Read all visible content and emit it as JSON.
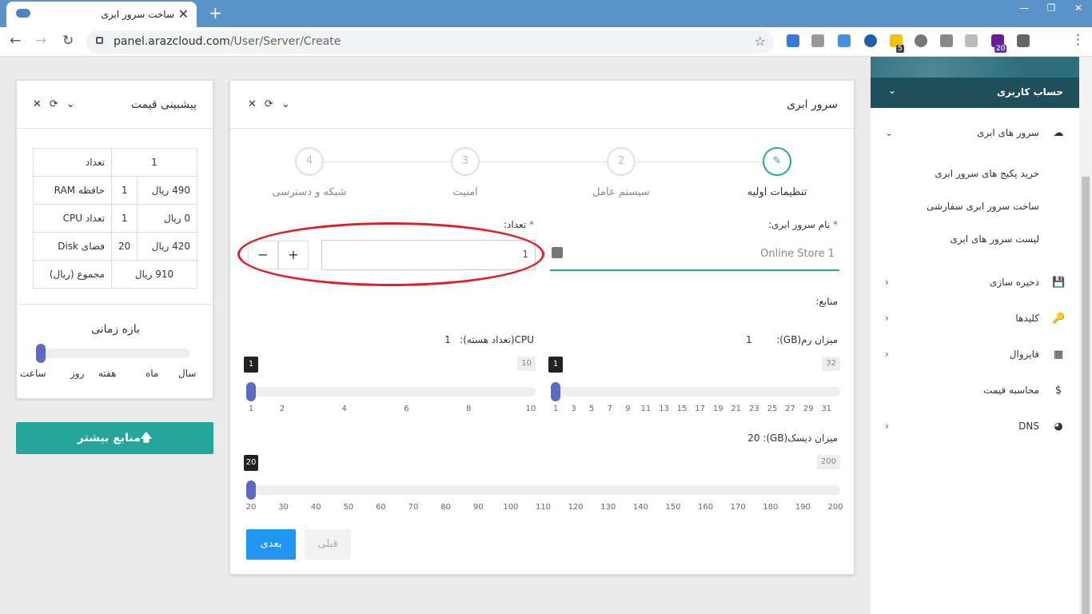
{
  "browser": {
    "tab_title": "ساخت سرور ابری",
    "tab_close": "✕",
    "new_tab": "+",
    "min": "—",
    "max": "❐",
    "close": "✕",
    "url_host": "panel.arazcloud.com",
    "url_path": "/User/Server/Create",
    "ext_badge_5": "5",
    "ext_badge_20": "20",
    "back": "←",
    "forward": "→",
    "reload": "↻",
    "star": "☆",
    "menu": "⋮"
  },
  "main": {
    "title": "سرور ابری",
    "ctrl_close": "✕",
    "ctrl_refresh": "⟳",
    "ctrl_collapse": "⌄",
    "steps": [
      {
        "num": "",
        "label": "تنظیمات اولیه"
      },
      {
        "num": "2",
        "label": "سیستم عامل"
      },
      {
        "num": "3",
        "label": "امنیت"
      },
      {
        "num": "4",
        "label": "شبکه و دسترسی"
      }
    ],
    "name_label": "نام سرور ابری:",
    "count_label": "تعداد:",
    "required": "*",
    "name_value": "Online Store 1",
    "count_value": "1",
    "minus": "−",
    "plus": "+",
    "resources_label": "منابع:",
    "ram_label": "میزان رم(GB):",
    "ram_value": "1",
    "cpu_label": "CPU(تعداد هسته):",
    "cpu_value": "1",
    "disk_label": "میزان دیسک(GB): 20",
    "ram_slider": {
      "value": 1,
      "min": 1,
      "max": 32,
      "max_label": "32",
      "tip": "1",
      "ticks": [
        "1",
        "3",
        "5",
        "7",
        "9",
        "11",
        "13",
        "15",
        "17",
        "19",
        "21",
        "23",
        "25",
        "27",
        "29",
        "31"
      ]
    },
    "cpu_slider": {
      "value": 1,
      "min": 1,
      "max": 10,
      "max_label": "10",
      "tip": "1",
      "ticks": [
        "1",
        "2",
        "4",
        "6",
        "8",
        "10"
      ]
    },
    "disk_slider": {
      "value": 20,
      "min": 20,
      "max": 200,
      "max_label": "200",
      "tip": "20",
      "ticks": [
        "20",
        "30",
        "40",
        "50",
        "60",
        "70",
        "80",
        "90",
        "100",
        "110",
        "120",
        "130",
        "140",
        "150",
        "160",
        "170",
        "180",
        "190",
        "200"
      ]
    },
    "next": "بعدی",
    "prev": "قبلی"
  },
  "price": {
    "title": "پیشبینی قیمت",
    "ctrl_close": "✕",
    "ctrl_refresh": "⟳",
    "ctrl_collapse": "⌄",
    "rows": {
      "count_label": "تعداد",
      "count_value": "1",
      "ram_label": "حافظه RAM",
      "ram_qty": "1",
      "ram_price": "490 ریال",
      "cpu_label": "تعداد CPU",
      "cpu_qty": "1",
      "cpu_price": "0 ریال",
      "disk_label": "فضای Disk",
      "disk_qty": "20",
      "disk_price": "420 ریال",
      "total_label": "مجموع (ریال)",
      "total_value": "910 ریال"
    },
    "period_title": "بازه زمانی",
    "period_labels": [
      "سال",
      "ماه",
      "هفته",
      "روز",
      "ساعت"
    ],
    "more_resources": "منابع بیشتر🡅"
  },
  "sidebar": {
    "account": "حساب کاربری",
    "account_chev": "⌄",
    "cloud_servers": "سرور های ابری",
    "cloud_chev": "⌄",
    "sub_items": [
      "خرید پکیج های سرور ابری",
      "ساخت سرور ابری سفارشی",
      "لیست سرور های ابری"
    ],
    "items": [
      {
        "label": "ذخیره سازی",
        "icon": "💾",
        "chev": "›"
      },
      {
        "label": "کلیدها",
        "icon": "🔑",
        "chev": "›"
      },
      {
        "label": "فایروال",
        "icon": "▦",
        "chev": "›"
      },
      {
        "label": "محاسبه قیمت",
        "icon": "$",
        "chev": ""
      },
      {
        "label": "DNS",
        "icon": "◕",
        "chev": "›"
      }
    ],
    "cloud_icon": "☁"
  },
  "colors": {
    "accent": "#26a69a",
    "slider": "#5c6bc0",
    "next_button": "#2196f3",
    "highlight": "#e11d2b"
  }
}
